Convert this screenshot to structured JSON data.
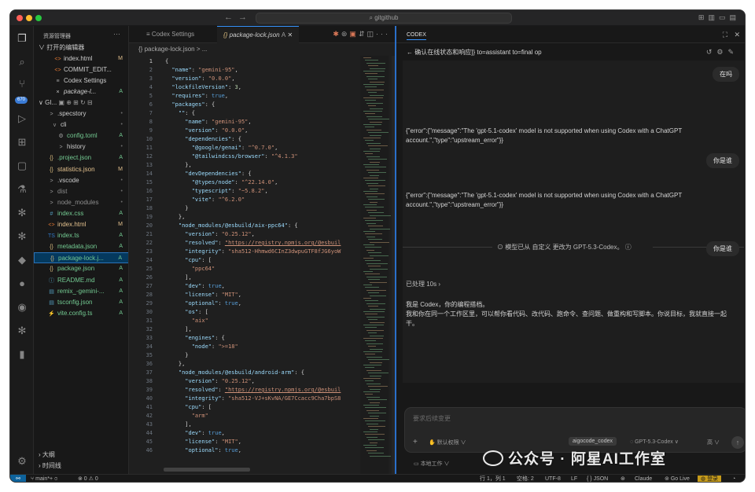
{
  "titlebar": {
    "search": "gitgithub",
    "back": "←",
    "forward": "→"
  },
  "activity_badge": "670",
  "sidebar": {
    "header": "资源管理器",
    "more": "···",
    "open_editors": "打开的编辑器",
    "open_items": [
      {
        "icon": "<>",
        "name": "index.html",
        "status": "M"
      },
      {
        "icon": "<>",
        "name": "COMMIT_EDIT...",
        "status": ""
      },
      {
        "icon": "≡",
        "name": "Codex Settings",
        "status": ""
      },
      {
        "icon": "×",
        "name": "package-l...",
        "status": "A"
      }
    ],
    "folder": "GI...",
    "tree": [
      {
        "icon": ">",
        "name": ".specstory",
        "status": "•"
      },
      {
        "icon": "v",
        "name": "cli",
        "status": "•"
      },
      {
        "icon": "⚙",
        "name": "config.toml",
        "status": "A"
      },
      {
        "icon": ">",
        "name": "history",
        "status": "•"
      },
      {
        "icon": "{}",
        "name": ".project.json",
        "status": "A"
      },
      {
        "icon": "{}",
        "name": "statistics.json",
        "status": "M"
      },
      {
        "icon": ">",
        "name": ".vscode",
        "status": "•"
      },
      {
        "icon": ">",
        "name": "dist",
        "status": "•"
      },
      {
        "icon": ">",
        "name": "node_modules",
        "status": "•"
      },
      {
        "icon": "#",
        "name": "index.css",
        "status": "A"
      },
      {
        "icon": "<>",
        "name": "index.html",
        "status": "M"
      },
      {
        "icon": "TS",
        "name": "index.ts",
        "status": "A"
      },
      {
        "icon": "{}",
        "name": "metadata.json",
        "status": "A"
      },
      {
        "icon": "{}",
        "name": "package-lock.j...",
        "status": "A"
      },
      {
        "icon": "{}",
        "name": "package.json",
        "status": "A"
      },
      {
        "icon": "ⓘ",
        "name": "README.md",
        "status": "A"
      },
      {
        "icon": "▤",
        "name": "remix_-gemini-...",
        "status": "A"
      },
      {
        "icon": "▤",
        "name": "tsconfig.json",
        "status": "A"
      },
      {
        "icon": "⚡",
        "name": "vite.config.ts",
        "status": "A"
      }
    ],
    "outline": "大纲",
    "timeline": "时间线"
  },
  "editor": {
    "tabs": [
      {
        "label": "Codex Settings",
        "icon": "≡"
      },
      {
        "label": "package-lock.json",
        "icon": "{}",
        "status": "A"
      }
    ],
    "breadcrumb": "{} package-lock.json > ...",
    "lines": [
      [
        [
          "p",
          "{"
        ]
      ],
      [
        [
          "k",
          "  \"name\""
        ],
        [
          "p",
          ": "
        ],
        [
          "s",
          "\"gemini-95\""
        ],
        [
          "p",
          ","
        ]
      ],
      [
        [
          "k",
          "  \"version\""
        ],
        [
          "p",
          ": "
        ],
        [
          "s",
          "\"0.0.0\""
        ],
        [
          "p",
          ","
        ]
      ],
      [
        [
          "k",
          "  \"lockfileVersion\""
        ],
        [
          "p",
          ": "
        ],
        [
          "n",
          "3"
        ],
        [
          "p",
          ","
        ]
      ],
      [
        [
          "k",
          "  \"requires\""
        ],
        [
          "p",
          ": "
        ],
        [
          "b",
          "true"
        ],
        [
          "p",
          ","
        ]
      ],
      [
        [
          "k",
          "  \"packages\""
        ],
        [
          "p",
          ": {"
        ]
      ],
      [
        [
          "k",
          "    \"\""
        ],
        [
          "p",
          ": {"
        ]
      ],
      [
        [
          "k",
          "      \"name\""
        ],
        [
          "p",
          ": "
        ],
        [
          "s",
          "\"gemini-95\""
        ],
        [
          "p",
          ","
        ]
      ],
      [
        [
          "k",
          "      \"version\""
        ],
        [
          "p",
          ": "
        ],
        [
          "s",
          "\"0.0.0\""
        ],
        [
          "p",
          ","
        ]
      ],
      [
        [
          "k",
          "      \"dependencies\""
        ],
        [
          "p",
          ": {"
        ]
      ],
      [
        [
          "k",
          "        \"@google/genai\""
        ],
        [
          "p",
          ": "
        ],
        [
          "s",
          "\"^0.7.0\""
        ],
        [
          "p",
          ","
        ]
      ],
      [
        [
          "k",
          "        \"@tailwindcss/browser\""
        ],
        [
          "p",
          ": "
        ],
        [
          "s",
          "\"^4.1.3\""
        ]
      ],
      [
        [
          "p",
          "      },"
        ]
      ],
      [
        [
          "k",
          "      \"devDependencies\""
        ],
        [
          "p",
          ": {"
        ]
      ],
      [
        [
          "k",
          "        \"@types/node\""
        ],
        [
          "p",
          ": "
        ],
        [
          "s",
          "\"^22.14.0\""
        ],
        [
          "p",
          ","
        ]
      ],
      [
        [
          "k",
          "        \"typescript\""
        ],
        [
          "p",
          ": "
        ],
        [
          "s",
          "\"~5.8.2\""
        ],
        [
          "p",
          ","
        ]
      ],
      [
        [
          "k",
          "        \"vite\""
        ],
        [
          "p",
          ": "
        ],
        [
          "s",
          "\"^6.2.0\""
        ]
      ],
      [
        [
          "p",
          "      }"
        ]
      ],
      [
        [
          "p",
          "    },"
        ]
      ],
      [
        [
          "k",
          "    \"node_modules/@esbuild/aix-ppc64\""
        ],
        [
          "p",
          ": {"
        ]
      ],
      [
        [
          "k",
          "      \"version\""
        ],
        [
          "p",
          ": "
        ],
        [
          "s",
          "\"0.25.12\""
        ],
        [
          "p",
          ","
        ]
      ],
      [
        [
          "k",
          "      \"resolved\""
        ],
        [
          "p",
          ": "
        ],
        [
          "u",
          "\"https://registry.npmjs.org/@esbuil"
        ]
      ],
      [
        [
          "k",
          "      \"integrity\""
        ],
        [
          "p",
          ": "
        ],
        [
          "s",
          "\"sha512-Hhmwd6CInZ3dwpuGTF8fJG6yoW"
        ]
      ],
      [
        [
          "k",
          "      \"cpu\""
        ],
        [
          "p",
          ": ["
        ]
      ],
      [
        [
          "s",
          "        \"ppc64\""
        ]
      ],
      [
        [
          "p",
          "      ],"
        ]
      ],
      [
        [
          "k",
          "      \"dev\""
        ],
        [
          "p",
          ": "
        ],
        [
          "b",
          "true"
        ],
        [
          "p",
          ","
        ]
      ],
      [
        [
          "k",
          "      \"license\""
        ],
        [
          "p",
          ": "
        ],
        [
          "s",
          "\"MIT\""
        ],
        [
          "p",
          ","
        ]
      ],
      [
        [
          "k",
          "      \"optional\""
        ],
        [
          "p",
          ": "
        ],
        [
          "b",
          "true"
        ],
        [
          "p",
          ","
        ]
      ],
      [
        [
          "k",
          "      \"os\""
        ],
        [
          "p",
          ": ["
        ]
      ],
      [
        [
          "s",
          "        \"aix\""
        ]
      ],
      [
        [
          "p",
          "      ],"
        ]
      ],
      [
        [
          "k",
          "      \"engines\""
        ],
        [
          "p",
          ": {"
        ]
      ],
      [
        [
          "k",
          "        \"node\""
        ],
        [
          "p",
          ": "
        ],
        [
          "s",
          "\">=18\""
        ]
      ],
      [
        [
          "p",
          "      }"
        ]
      ],
      [
        [
          "p",
          "    },"
        ]
      ],
      [
        [
          "k",
          "    \"node_modules/@esbuild/android-arm\""
        ],
        [
          "p",
          ": {"
        ]
      ],
      [
        [
          "k",
          "      \"version\""
        ],
        [
          "p",
          ": "
        ],
        [
          "s",
          "\"0.25.12\""
        ],
        [
          "p",
          ","
        ]
      ],
      [
        [
          "k",
          "      \"resolved\""
        ],
        [
          "p",
          ": "
        ],
        [
          "u",
          "\"https://registry.npmjs.org/@esbuil"
        ]
      ],
      [
        [
          "k",
          "      \"integrity\""
        ],
        [
          "p",
          ": "
        ],
        [
          "s",
          "\"sha512-VJ+sKvNA/GE7Ccacc9Cha7bpS8"
        ]
      ],
      [
        [
          "k",
          "      \"cpu\""
        ],
        [
          "p",
          ": ["
        ]
      ],
      [
        [
          "s",
          "        \"arm\""
        ]
      ],
      [
        [
          "p",
          "      ],"
        ]
      ],
      [
        [
          "k",
          "      \"dev\""
        ],
        [
          "p",
          ": "
        ],
        [
          "b",
          "true"
        ],
        [
          "p",
          ","
        ]
      ],
      [
        [
          "k",
          "      \"license\""
        ],
        [
          "p",
          ": "
        ],
        [
          "s",
          "\"MIT\""
        ],
        [
          "p",
          ","
        ]
      ],
      [
        [
          "k",
          "      \"optional\""
        ],
        [
          "p",
          ": "
        ],
        [
          "b",
          "true"
        ],
        [
          "p",
          ","
        ]
      ]
    ]
  },
  "codex": {
    "title": "CODEX",
    "subtitle": "确认在线状态和响应]} to=assistant to=final op",
    "messages": {
      "user1": "在吗",
      "error1": "{\"error\":{\"message\":\"The 'gpt-5.1-codex' model is not supported when using Codex with a ChatGPT account.\",\"type\":\"upstream_error\"}}",
      "user2": "你是谁",
      "error2": "{\"error\":{\"message\":\"The 'gpt-5.1-codex' model is not supported when using Codex with a ChatGPT account.\",\"type\":\"upstream_error\"}}",
      "model_change": "模型已从 自定义 更改为 GPT-5.3-Codex。",
      "user3": "你是谁",
      "processed": "已处理 10s",
      "reply_line1": "我是 Codex，你的编程搭档。",
      "reply_line2": "我和你在同一个工作区里，可以帮你看代码、改代码、跑命令、查问题、做重构和写脚本。你说目标，我就直接一起干。"
    },
    "composer": {
      "placeholder": "要求后续变更",
      "permission": "默认权限",
      "chip": "aigocode_codex",
      "model": "GPT-5.3-Codex",
      "effort": "高",
      "footer": "本地工作"
    }
  },
  "statusbar": {
    "branch": "main*+",
    "problems": "⊗ 0 ⚠ 0",
    "position": "行 1，列 1",
    "spaces": "空格: 2",
    "encoding": "UTF-8",
    "eol": "LF",
    "language": "{ } JSON",
    "claude": "Claude",
    "golive": "Go Live",
    "login": "登录"
  },
  "watermark": "公众号 · 阿星AI工作室"
}
